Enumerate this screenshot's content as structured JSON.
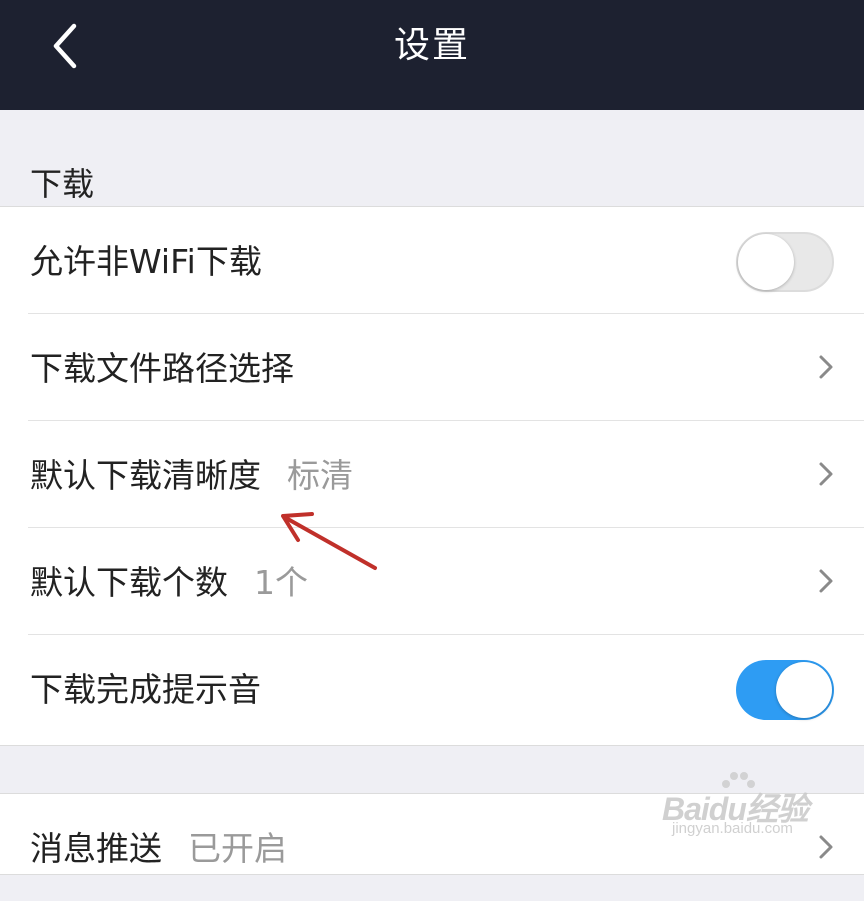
{
  "header": {
    "title": "设置",
    "back_icon": "chevron-left-icon"
  },
  "download_section": {
    "title": "下载",
    "rows": [
      {
        "label": "允许非WiFi下载",
        "type": "toggle",
        "enabled": false
      },
      {
        "label": "下载文件路径选择",
        "type": "link",
        "value": ""
      },
      {
        "label": "默认下载清晰度",
        "type": "link",
        "value": "标清"
      },
      {
        "label": "默认下载个数",
        "type": "link",
        "value": "1个"
      },
      {
        "label": "下载完成提示音",
        "type": "toggle",
        "enabled": true
      }
    ]
  },
  "message_section": {
    "rows": [
      {
        "label": "消息推送",
        "type": "link",
        "value": "已开启"
      }
    ]
  },
  "colors": {
    "header_bg": "#1d2130",
    "toggle_on": "#2e9cf3",
    "annotation_arrow": "#c0302a"
  },
  "watermark": {
    "logo": "Baidu经验",
    "url": "jingyan.baidu.com"
  }
}
